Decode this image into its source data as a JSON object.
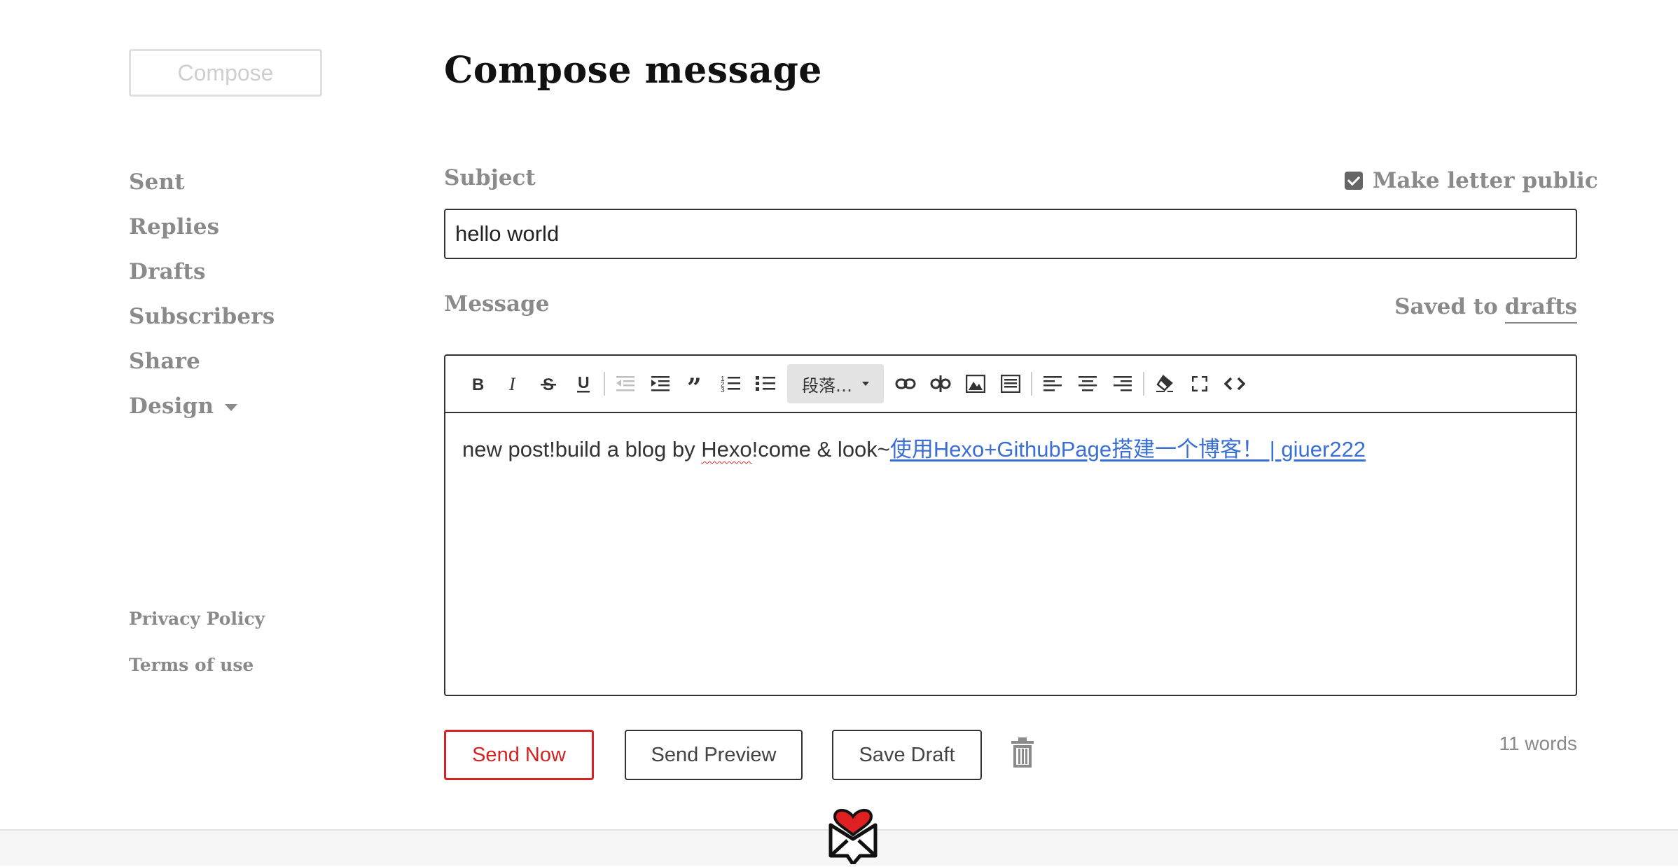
{
  "sidebar": {
    "compose_label": "Compose",
    "nav": [
      "Sent",
      "Replies",
      "Drafts",
      "Subscribers",
      "Share",
      "Design"
    ],
    "footer_links": [
      "Privacy Policy",
      "Terms of use"
    ]
  },
  "main": {
    "title": "Compose message",
    "subject_label": "Subject",
    "make_public_label": "Make letter public",
    "make_public_checked": true,
    "subject_value": "hello world",
    "message_label": "Message",
    "saved_text": "Saved to",
    "saved_link": "drafts",
    "editor": {
      "paragraph_select": "段落…",
      "body_text_1": "new post!build a blog by ",
      "body_text_misspelled": "Hexo",
      "body_text_2": "!come & look~",
      "body_link": "使用Hexo+GithubPage搭建一个博客！ | giuer222"
    },
    "buttons": {
      "send_now": "Send Now",
      "send_preview": "Send Preview",
      "save_draft": "Save Draft"
    },
    "word_count": "11 words"
  },
  "colors": {
    "accent": "#d52323",
    "muted": "#8a8a8a",
    "link": "#3a6fd6"
  },
  "icons": [
    "bold-icon",
    "italic-icon",
    "strikethrough-icon",
    "underline-icon",
    "outdent-icon",
    "indent-icon",
    "blockquote-icon",
    "ordered-list-icon",
    "bullet-list-icon",
    "link-icon",
    "unlink-icon",
    "image-icon",
    "embed-icon",
    "align-left-icon",
    "align-center-icon",
    "align-right-icon",
    "clear-format-icon",
    "fullscreen-icon",
    "code-icon",
    "trash-icon",
    "logo-icon"
  ]
}
